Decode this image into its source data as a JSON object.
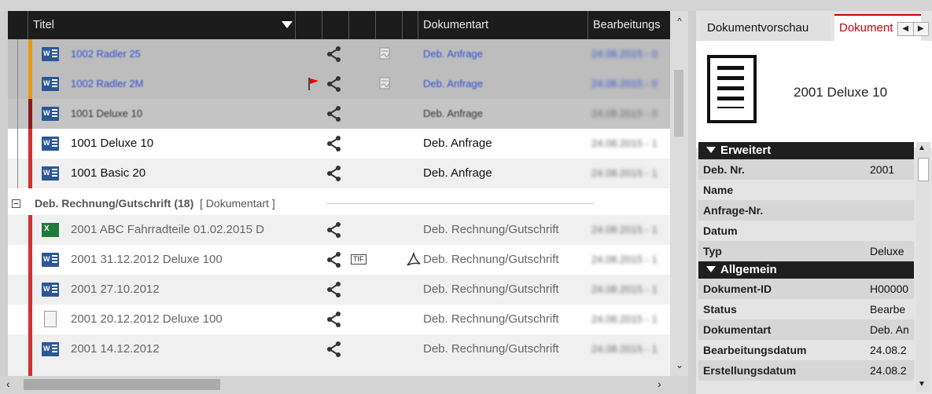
{
  "grid": {
    "columns": [
      "Titel",
      "Dokumentart",
      "Bearbeitungs"
    ],
    "rows_top": [
      {
        "title": "1002 Radler 25",
        "dokart": "Deb. Anfrage",
        "bdate": "24.08.2015 - 0",
        "band": "#e39a1a",
        "style": "greyblue",
        "flag": false,
        "sig": true,
        "icon": "word"
      },
      {
        "title": "1002 Radler 2M",
        "dokart": "Deb. Anfrage",
        "bdate": "24.08.2015 - 0",
        "band": "#e39a1a",
        "style": "greyblue",
        "flag": true,
        "sig": true,
        "icon": "word"
      },
      {
        "title": "1001 Deluxe 10",
        "dokart": "Deb. Anfrage",
        "bdate": "24.08.2015 - 0",
        "band": "#8b1a1a",
        "style": "grey",
        "flag": false,
        "sig": false,
        "icon": "word"
      },
      {
        "title": "1001 Deluxe 10",
        "dokart": "Deb. Anfrage",
        "bdate": "24.08.2015 - 1",
        "band": "#cc3333",
        "style": "white",
        "flag": false,
        "sig": false,
        "icon": "word"
      },
      {
        "title": "1001 Basic 20",
        "dokart": "Deb. Anfrage",
        "bdate": "24.08.2015 - 1",
        "band": "#cc3333",
        "style": "light",
        "flag": false,
        "sig": false,
        "icon": "word"
      }
    ],
    "group": {
      "label": "Deb. Rechnung/Gutschrift (18)",
      "tag": "[ Dokumentart ]"
    },
    "rows_bottom": [
      {
        "title": "2001 ABC Fahrradteile 01.02.2015 D",
        "dokart": "Deb. Rechnung/Gutschrift",
        "bdate": "24.08.2015 - 1",
        "band": "#cc3333",
        "icon": "excel",
        "tif": false,
        "pdf": false
      },
      {
        "title": "2001   31.12.2012 Deluxe 100",
        "dokart": "Deb. Rechnung/Gutschrift",
        "bdate": "24.08.2015 - 1",
        "band": "#cc3333",
        "icon": "word",
        "tif": true,
        "pdf": true
      },
      {
        "title": "2001   27.10.2012",
        "dokart": "Deb. Rechnung/Gutschrift",
        "bdate": "24.08.2015 - 1",
        "band": "#cc3333",
        "icon": "word",
        "tif": false,
        "pdf": false
      },
      {
        "title": "2001   20.12.2012 Deluxe 100",
        "dokart": "Deb. Rechnung/Gutschrift",
        "bdate": "24.08.2015 - 1",
        "band": "#cc3333",
        "icon": "page",
        "tif": false,
        "pdf": false
      },
      {
        "title": "2001   14.12.2012",
        "dokart": "Deb. Rechnung/Gutschrift",
        "bdate": "24.08.2015 - 1",
        "band": "#cc3333",
        "icon": "word",
        "tif": false,
        "pdf": false
      }
    ],
    "tif_label": "TIF"
  },
  "panel": {
    "tabs": [
      "Dokumentvorschau",
      "Dokument"
    ],
    "preview_title": "2001  Deluxe 10",
    "sections": [
      {
        "title": "Erweitert",
        "props": [
          {
            "k": "Deb. Nr.",
            "v": "2001"
          },
          {
            "k": "Name",
            "v": ""
          },
          {
            "k": "Anfrage-Nr.",
            "v": ""
          },
          {
            "k": "Datum",
            "v": ""
          },
          {
            "k": "Typ",
            "v": "Deluxe"
          }
        ]
      },
      {
        "title": "Allgemein",
        "props": [
          {
            "k": "Dokument-ID",
            "v": "H00000"
          },
          {
            "k": "Status",
            "v": "Bearbe"
          },
          {
            "k": "Dokumentart",
            "v": "Deb. An"
          },
          {
            "k": "Bearbeitungsdatum",
            "v": "24.08.2"
          },
          {
            "k": "Erstellungsdatum",
            "v": "24.08.2"
          }
        ]
      }
    ]
  },
  "colors": {
    "header_bg": "#1c1c1c",
    "accent_red": "#cc0000",
    "band_orange": "#e39a1a",
    "band_red": "#cc3333",
    "link_blue": "#2e4fd4"
  }
}
